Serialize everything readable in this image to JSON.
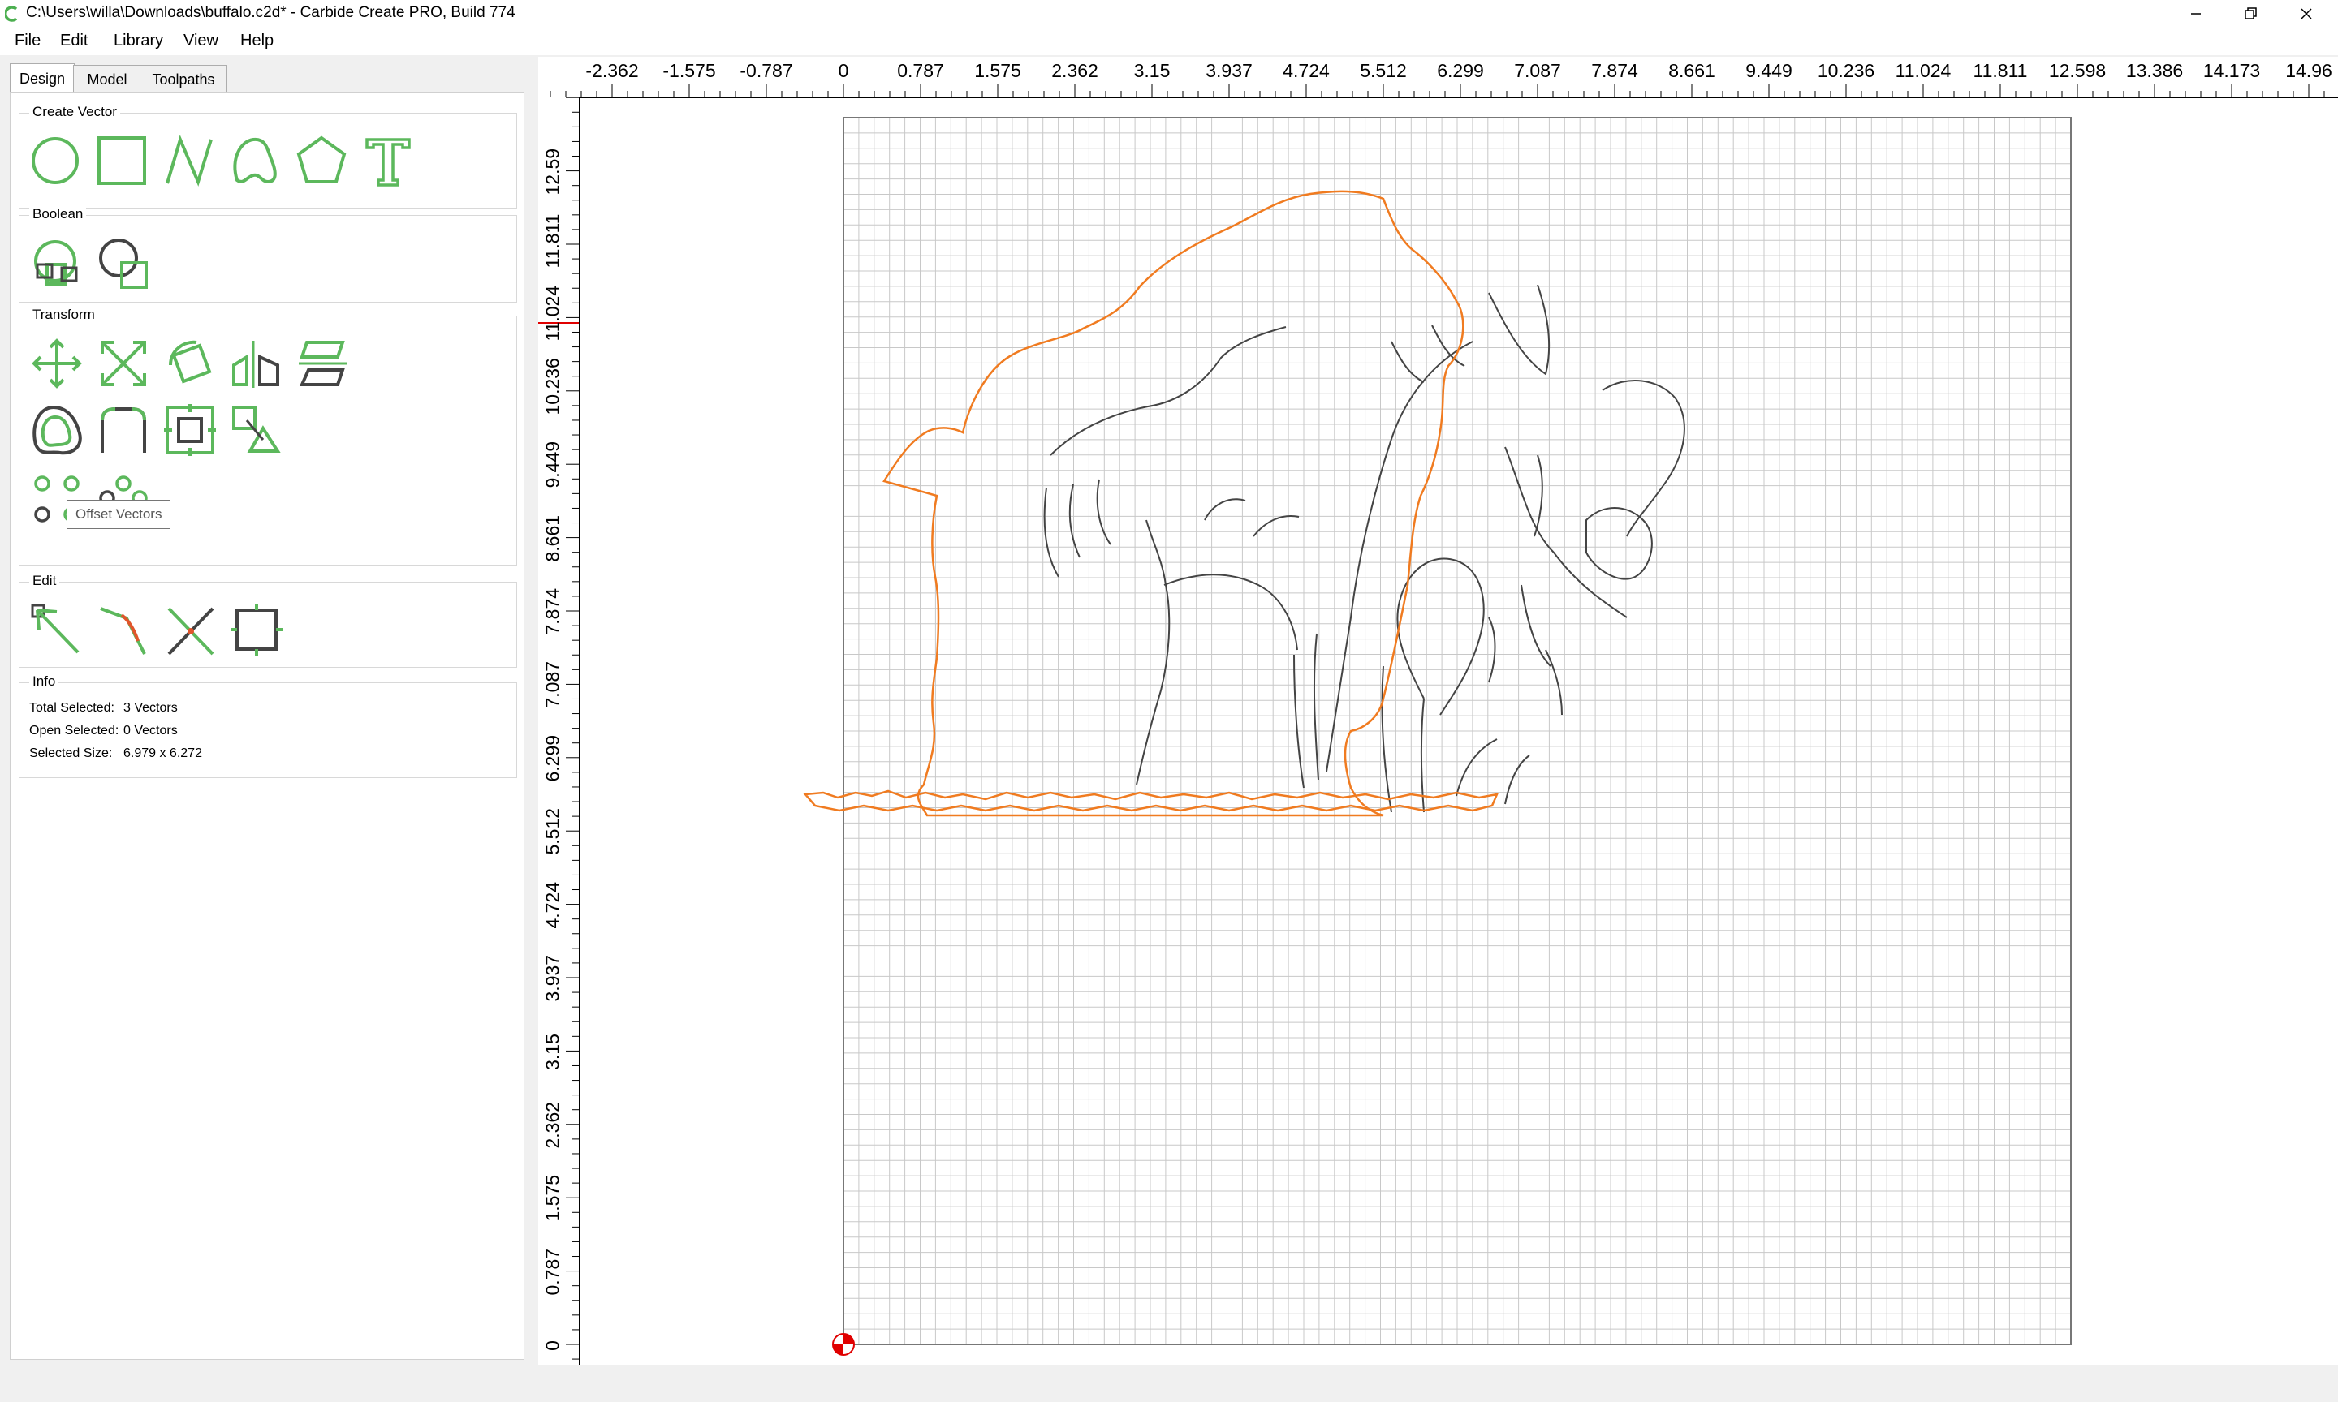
{
  "window": {
    "title": "C:\\Users\\willa\\Downloads\\buffalo.c2d* - Carbide Create PRO, Build 774",
    "controls": [
      "minimize-icon",
      "restore-icon",
      "close-icon"
    ]
  },
  "menu": [
    "File",
    "Edit",
    "Library",
    "View",
    "Help"
  ],
  "tabs": [
    {
      "label": "Design",
      "active": true
    },
    {
      "label": "Model",
      "active": false
    },
    {
      "label": "Toolpaths",
      "active": false
    }
  ],
  "groups": {
    "create_vector": {
      "title": "Create Vector",
      "tools": [
        "circle-icon",
        "rectangle-icon",
        "polyline-icon",
        "curve-icon",
        "polygon-icon",
        "text-icon"
      ]
    },
    "boolean": {
      "title": "Boolean",
      "tools": [
        "boolean-union-icon",
        "boolean-subtract-icon"
      ]
    },
    "transform": {
      "title": "Transform",
      "tools": [
        "move-icon",
        "scale-icon",
        "rotate-icon",
        "mirror-icon",
        "skew-icon",
        "offset-icon",
        "fillet-icon",
        "align-icon",
        "array-icon",
        "circular-array-icon",
        "grid-array-icon"
      ]
    },
    "edit": {
      "title": "Edit",
      "tools": [
        "node-edit-icon",
        "curve-edit-icon",
        "trim-icon",
        "bounding-box-icon"
      ]
    },
    "info": {
      "title": "Info",
      "total_selected_label": "Total Selected:",
      "total_selected_value": "3 Vectors",
      "open_selected_label": "Open Selected:",
      "open_selected_value": "0 Vectors",
      "selected_size_label": "Selected Size:",
      "selected_size_value": "6.979 x 6.272"
    }
  },
  "tooltip": "Offset Vectors",
  "ruler": {
    "horizontal": [
      "-2.362",
      "-1.575",
      "-0.787",
      "0",
      "0.787",
      "1.575",
      "2.362",
      "3.15",
      "3.937",
      "4.724",
      "5.512",
      "6.299",
      "7.087",
      "7.874",
      "8.661",
      "9.449",
      "10.236",
      "11.024",
      "11.811",
      "12.598",
      "13.386",
      "14.173",
      "14.96"
    ],
    "vertical": [
      "12.59",
      "11.811",
      "11.024",
      "10.236",
      "9.449",
      "8.661",
      "7.874",
      "7.087",
      "6.299",
      "5.512",
      "4.724",
      "3.937",
      "3.15",
      "2.362",
      "1.575",
      "0.787",
      "0"
    ]
  },
  "colors": {
    "accent_green": "#5cb85c",
    "selection_orange": "#f07b20",
    "vector_gray": "#444444",
    "grid": "#c8c8c8"
  }
}
